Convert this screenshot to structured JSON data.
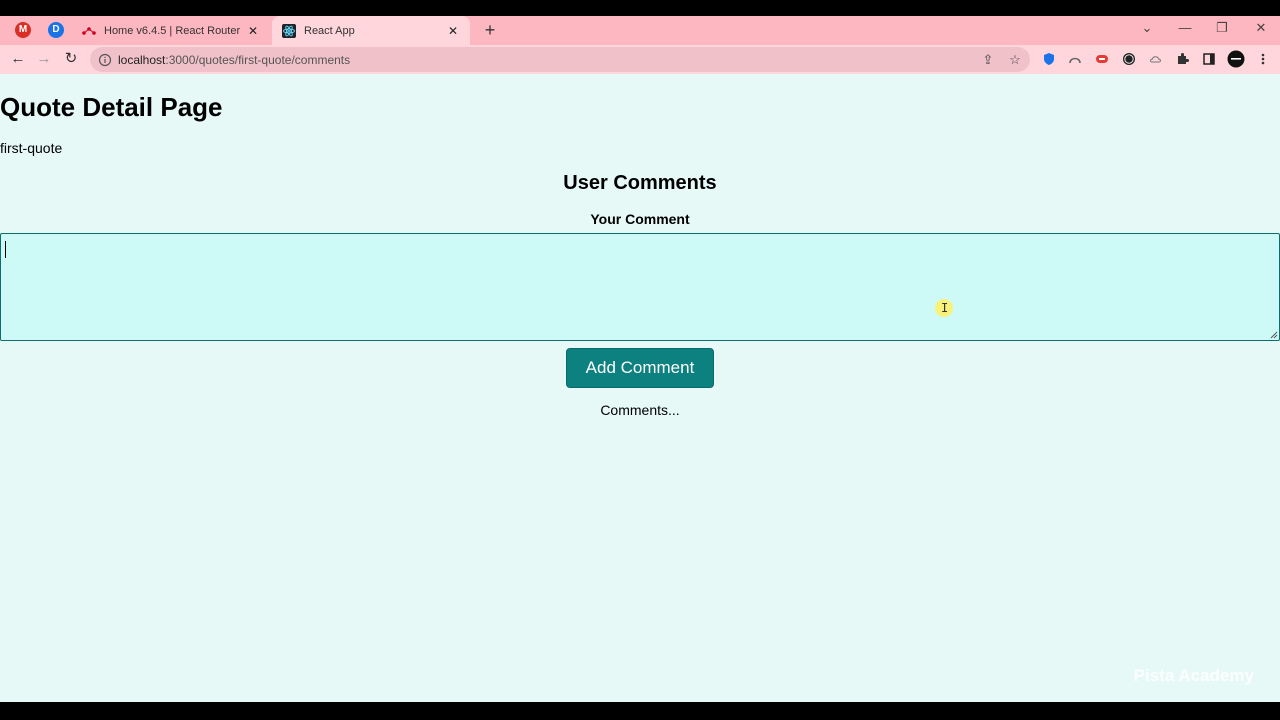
{
  "browser": {
    "pinned_tabs": [
      {
        "icon": "gmail-icon",
        "letter": "M",
        "color": "#d93025"
      },
      {
        "icon": "d-app-icon",
        "letter": "D",
        "color": "#1a73e8"
      }
    ],
    "tabs": [
      {
        "title": "Home v6.4.5 | React Router",
        "icon": "react-router-icon",
        "active": false
      },
      {
        "title": "React App",
        "icon": "react-icon",
        "active": true
      }
    ],
    "url_host": "localhost",
    "url_path": ":3000/quotes/first-quote/comments",
    "tabbar_color": "#fdb7c1",
    "toolbar_color": "#ffd6dc"
  },
  "page": {
    "title": "Quote Detail Page",
    "quote_id": "first-quote",
    "section_title": "User Comments",
    "comment_label": "Your Comment",
    "comment_value": "",
    "add_button_label": "Add Comment",
    "comments_status": "Comments...",
    "background": "#e6f9f7",
    "accent": "#0d8080"
  },
  "overlay": {
    "watermark": "Pista Academy"
  }
}
